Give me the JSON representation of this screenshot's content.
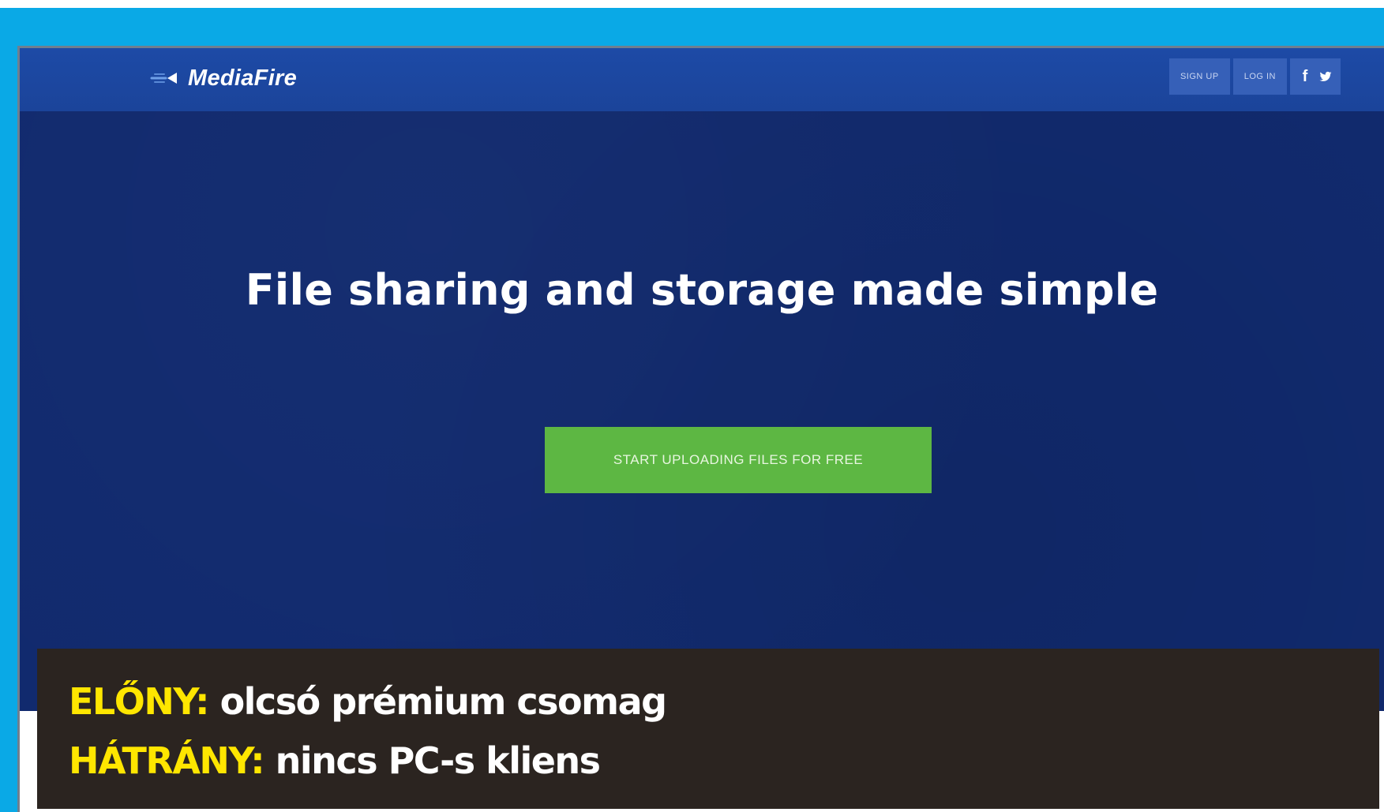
{
  "navbar": {
    "logo_text": "MediaFire",
    "signup_label": "SIGN UP",
    "login_label": "LOG IN",
    "facebook_glyph": "f",
    "twitter_glyph": "twitter-icon"
  },
  "hero": {
    "title": "File sharing and storage made simple",
    "cta_label": "START UPLOADING FILES FOR FREE"
  },
  "caption": {
    "pro_key": "ELŐNY:",
    "pro_value": "olcsó prémium csomag",
    "con_key": "HÁTRÁNY:",
    "con_value": "nincs PC-s kliens"
  },
  "colors": {
    "frame": "#0aa9e6",
    "navbar": "#1d4aa6",
    "hero": "#112a6e",
    "cta": "#5db743",
    "caption_bg": "#2b2420",
    "caption_key": "#ffe600"
  }
}
